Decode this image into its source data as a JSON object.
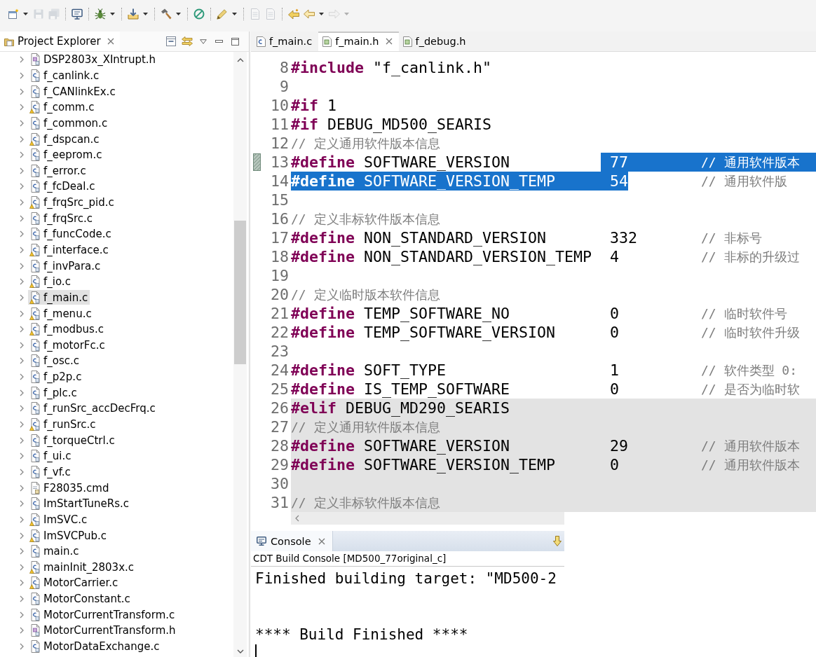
{
  "toolbar": [
    [
      {
        "disabled": false,
        "dropdown": true
      },
      {
        "disabled": true,
        "dropdown": false
      },
      {
        "disabled": true,
        "dropdown": false
      }
    ],
    [
      {
        "disabled": false,
        "dropdown": false
      }
    ],
    [
      {
        "disabled": false,
        "dropdown": true
      }
    ],
    [
      {
        "disabled": false,
        "dropdown": true
      }
    ],
    [
      {
        "disabled": false,
        "dropdown": true
      }
    ],
    [
      {
        "disabled": false,
        "dropdown": false
      }
    ],
    [
      {
        "disabled": false,
        "dropdown": true
      }
    ],
    [
      {
        "disabled": true,
        "dropdown": false
      },
      {
        "disabled": true,
        "dropdown": false
      }
    ],
    [
      {
        "disabled": false,
        "dropdown": false
      },
      {
        "disabled": false,
        "dropdown": true
      },
      {
        "disabled": true,
        "dropdown": true
      }
    ]
  ],
  "explorer": {
    "title": "Project Explorer",
    "items": [
      {
        "name": "DSP2803x_XIntrupt.h",
        "kind": "h",
        "warning": false,
        "expanded": false,
        "selected": false
      },
      {
        "name": "f_canlink.c",
        "kind": "c",
        "warning": false,
        "expanded": false,
        "selected": false
      },
      {
        "name": "f_CANlinkEx.c",
        "kind": "c",
        "warning": false,
        "expanded": false,
        "selected": false
      },
      {
        "name": "f_comm.c",
        "kind": "c",
        "warning": true,
        "expanded": false,
        "selected": false
      },
      {
        "name": "f_common.c",
        "kind": "c",
        "warning": false,
        "expanded": false,
        "selected": false
      },
      {
        "name": "f_dspcan.c",
        "kind": "c",
        "warning": true,
        "expanded": false,
        "selected": false
      },
      {
        "name": "f_eeprom.c",
        "kind": "c",
        "warning": false,
        "expanded": false,
        "selected": false
      },
      {
        "name": "f_error.c",
        "kind": "c",
        "warning": false,
        "expanded": false,
        "selected": false
      },
      {
        "name": "f_fcDeal.c",
        "kind": "c",
        "warning": false,
        "expanded": false,
        "selected": false
      },
      {
        "name": "f_frqSrc_pid.c",
        "kind": "c",
        "warning": true,
        "expanded": false,
        "selected": false
      },
      {
        "name": "f_frqSrc.c",
        "kind": "c",
        "warning": false,
        "expanded": false,
        "selected": false
      },
      {
        "name": "f_funcCode.c",
        "kind": "c",
        "warning": false,
        "expanded": false,
        "selected": false
      },
      {
        "name": "f_interface.c",
        "kind": "c",
        "warning": true,
        "expanded": false,
        "selected": false
      },
      {
        "name": "f_invPara.c",
        "kind": "c",
        "warning": false,
        "expanded": false,
        "selected": false
      },
      {
        "name": "f_io.c",
        "kind": "c",
        "warning": true,
        "expanded": false,
        "selected": false
      },
      {
        "name": "f_main.c",
        "kind": "c",
        "warning": true,
        "expanded": false,
        "selected": true
      },
      {
        "name": "f_menu.c",
        "kind": "c",
        "warning": true,
        "expanded": false,
        "selected": false
      },
      {
        "name": "f_modbus.c",
        "kind": "c",
        "warning": true,
        "expanded": false,
        "selected": false
      },
      {
        "name": "f_motorFc.c",
        "kind": "c",
        "warning": false,
        "expanded": false,
        "selected": false
      },
      {
        "name": "f_osc.c",
        "kind": "c",
        "warning": false,
        "expanded": false,
        "selected": false
      },
      {
        "name": "f_p2p.c",
        "kind": "c",
        "warning": false,
        "expanded": false,
        "selected": false
      },
      {
        "name": "f_plc.c",
        "kind": "c",
        "warning": false,
        "expanded": false,
        "selected": false
      },
      {
        "name": "f_runSrc_accDecFrq.c",
        "kind": "c",
        "warning": false,
        "expanded": false,
        "selected": false
      },
      {
        "name": "f_runSrc.c",
        "kind": "c",
        "warning": true,
        "expanded": false,
        "selected": false
      },
      {
        "name": "f_torqueCtrl.c",
        "kind": "c",
        "warning": false,
        "expanded": false,
        "selected": false
      },
      {
        "name": "f_ui.c",
        "kind": "c",
        "warning": false,
        "expanded": false,
        "selected": false
      },
      {
        "name": "f_vf.c",
        "kind": "c",
        "warning": false,
        "expanded": false,
        "selected": false
      },
      {
        "name": "F28035.cmd",
        "kind": "cmd",
        "warning": false,
        "expanded": false,
        "selected": false
      },
      {
        "name": "ImStartTuneRs.c",
        "kind": "c",
        "warning": false,
        "expanded": false,
        "selected": false
      },
      {
        "name": "ImSVC.c",
        "kind": "c",
        "warning": true,
        "expanded": false,
        "selected": false
      },
      {
        "name": "ImSVCPub.c",
        "kind": "c",
        "warning": true,
        "expanded": false,
        "selected": false
      },
      {
        "name": "main.c",
        "kind": "c",
        "warning": false,
        "expanded": false,
        "selected": false
      },
      {
        "name": "mainInit_2803x.c",
        "kind": "c",
        "warning": true,
        "expanded": false,
        "selected": false
      },
      {
        "name": "MotorCarrier.c",
        "kind": "c",
        "warning": true,
        "expanded": false,
        "selected": false
      },
      {
        "name": "MotorConstant.c",
        "kind": "c",
        "warning": false,
        "expanded": false,
        "selected": false
      },
      {
        "name": "MotorCurrentTransform.c",
        "kind": "c",
        "warning": false,
        "expanded": false,
        "selected": false
      },
      {
        "name": "MotorCurrentTransform.h",
        "kind": "h",
        "warning": false,
        "expanded": false,
        "selected": false
      },
      {
        "name": "MotorDataExchange.c",
        "kind": "c",
        "expanded": false,
        "selected": false
      }
    ]
  },
  "editor": {
    "tabs": [
      {
        "label": "f_main.c",
        "kind": "c",
        "selected": false
      },
      {
        "label": "f_main.h",
        "kind": "h",
        "selected": true
      },
      {
        "label": "f_debug.h",
        "kind": "h",
        "selected": false
      }
    ],
    "lines": [
      {
        "no": "8",
        "kind": "code",
        "code": "**#include** \"f_canlink.h\"",
        "code_selected": false,
        "inactive": false,
        "marked": false
      },
      {
        "no": "9",
        "kind": "blank",
        "inactive": false,
        "marked": false
      },
      {
        "no": "10",
        "kind": "code",
        "code": "**#if** 1",
        "code_selected": false,
        "inactive": false,
        "marked": false
      },
      {
        "no": "11",
        "kind": "code",
        "code": "**#if** DEBUG_MD500_SEARIS",
        "code_selected": false,
        "inactive": false,
        "marked": false
      },
      {
        "no": "12",
        "kind": "comment",
        "comment": "// 定义通用软件版本信息",
        "inactive": false,
        "marked": false
      },
      {
        "no": "13",
        "kind": "code",
        "code": "**#define** SOFTWARE_VERSION",
        "value": "77",
        "comment": "// 通用软件版本",
        "code_selected": false,
        "value_selected": true,
        "comment_selected": true,
        "inactive": false,
        "marked": true
      },
      {
        "no": "14",
        "kind": "code",
        "code": "**#define** SOFTWARE_VERSION_TEMP",
        "value": "54",
        "comment": "// 通用软件版",
        "code_selected": true,
        "value_selected": true,
        "comment_selected": false,
        "inactive": false,
        "marked": false
      },
      {
        "no": "15",
        "kind": "blank",
        "inactive": false,
        "marked": false
      },
      {
        "no": "16",
        "kind": "comment",
        "comment": "// 定义非标软件版本信息",
        "inactive": false,
        "marked": false
      },
      {
        "no": "17",
        "kind": "code",
        "code": "**#define** NON_STANDARD_VERSION",
        "value": "332",
        "comment": "// 非标号",
        "code_selected": false,
        "value_selected": false,
        "comment_selected": false,
        "inactive": false,
        "marked": false
      },
      {
        "no": "18",
        "kind": "code",
        "code": "**#define** NON_STANDARD_VERSION_TEMP",
        "value": "4",
        "comment": "// 非标的升级过",
        "code_selected": false,
        "value_selected": false,
        "comment_selected": false,
        "inactive": false,
        "marked": false
      },
      {
        "no": "19",
        "kind": "blank",
        "inactive": false,
        "marked": false
      },
      {
        "no": "20",
        "kind": "comment",
        "comment": "// 定义临时版本软件信息",
        "inactive": false,
        "marked": false
      },
      {
        "no": "21",
        "kind": "code",
        "code": "**#define** TEMP_SOFTWARE_NO",
        "value": "0",
        "comment": "// 临时软件号",
        "code_selected": false,
        "value_selected": false,
        "comment_selected": false,
        "inactive": false,
        "marked": false
      },
      {
        "no": "22",
        "kind": "code",
        "code": "**#define** TEMP_SOFTWARE_VERSION",
        "value": "0",
        "comment": "// 临时软件升级",
        "code_selected": false,
        "value_selected": false,
        "comment_selected": false,
        "inactive": false,
        "marked": false
      },
      {
        "no": "23",
        "kind": "blank",
        "inactive": false,
        "marked": false
      },
      {
        "no": "24",
        "kind": "code",
        "code": "**#define** SOFT_TYPE",
        "value": "1",
        "comment": "// 软件类型 0:",
        "code_selected": false,
        "value_selected": false,
        "comment_selected": false,
        "inactive": false,
        "marked": false
      },
      {
        "no": "25",
        "kind": "code",
        "code": "**#define** IS_TEMP_SOFTWARE",
        "value": "0",
        "comment": "// 是否为临时软",
        "code_selected": false,
        "value_selected": false,
        "comment_selected": false,
        "inactive": false,
        "marked": false
      },
      {
        "no": "26",
        "kind": "code",
        "code": "**#elif** DEBUG_MD290_SEARIS",
        "code_selected": false,
        "inactive": true,
        "marked": false
      },
      {
        "no": "27",
        "kind": "comment",
        "comment": "// 定义通用软件版本信息",
        "inactive": true,
        "marked": false
      },
      {
        "no": "28",
        "kind": "code",
        "code": "**#define** SOFTWARE_VERSION",
        "value": "29",
        "comment": "// 通用软件版本",
        "code_selected": false,
        "value_selected": false,
        "comment_selected": false,
        "inactive": true,
        "marked": false
      },
      {
        "no": "29",
        "kind": "code",
        "code": "**#define** SOFTWARE_VERSION_TEMP",
        "value": "0",
        "comment": "// 通用软件版本",
        "code_selected": false,
        "value_selected": false,
        "comment_selected": false,
        "inactive": true,
        "marked": false
      },
      {
        "no": "30",
        "kind": "blank",
        "inactive": true,
        "marked": false
      },
      {
        "no": "31",
        "kind": "comment",
        "comment": "// 定义非标软件版本信息",
        "inactive": true,
        "marked": false
      }
    ]
  },
  "console": {
    "title": "Console",
    "header": "CDT Build Console [MD500_77original_c]",
    "lines": [
      "Finished building target: \"MD500-2",
      "**** Build Finished ****"
    ]
  }
}
